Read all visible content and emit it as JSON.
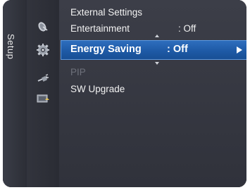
{
  "sidebar": {
    "title": "Setup",
    "icons": [
      "satellite-dish-icon",
      "gear-icon",
      "network-plug-icon",
      "input-source-icon"
    ]
  },
  "menu": {
    "items": [
      {
        "label": "External Settings",
        "value": "",
        "enabled": true
      },
      {
        "label": "Entertainment",
        "value": ": Off",
        "enabled": true
      },
      {
        "label": "Energy Saving",
        "value": ": Off",
        "enabled": true,
        "selected": true
      },
      {
        "label": "PIP",
        "value": "",
        "enabled": false
      },
      {
        "label": "SW Upgrade",
        "value": "",
        "enabled": true
      }
    ]
  },
  "colors": {
    "highlight": "#1e5aa6",
    "panel": "#3c3e48",
    "text": "#f2f2f2",
    "disabled_text": "#6e717b"
  }
}
